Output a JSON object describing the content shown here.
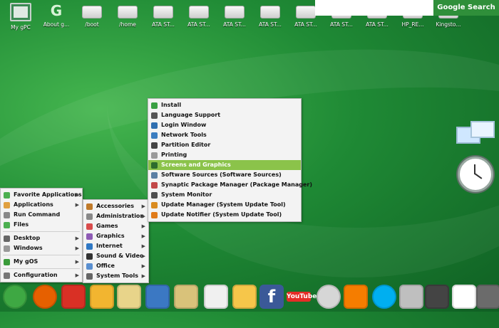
{
  "desktop_icons": [
    {
      "label": "My gPC",
      "icon": "monitor-icon"
    },
    {
      "label": "About g...",
      "icon": "about-icon"
    },
    {
      "label": "/boot",
      "icon": "drive-icon"
    },
    {
      "label": "/home",
      "icon": "drive-icon"
    },
    {
      "label": "ATA ST...",
      "icon": "drive-icon"
    },
    {
      "label": "ATA ST...",
      "icon": "drive-icon"
    },
    {
      "label": "ATA ST...",
      "icon": "drive-icon"
    },
    {
      "label": "ATA ST...",
      "icon": "drive-icon"
    },
    {
      "label": "ATA ST...",
      "icon": "drive-icon"
    },
    {
      "label": "ATA ST...",
      "icon": "drive-icon"
    },
    {
      "label": "ATA ST...",
      "icon": "drive-icon"
    },
    {
      "label": "HP_RE...",
      "icon": "drive-icon"
    },
    {
      "label": "Kingsto...",
      "icon": "drive-icon"
    }
  ],
  "search": {
    "value": "",
    "button_label": "Google Search"
  },
  "main_menu": [
    {
      "label": "Favorite Applications",
      "icon": "heart-icon",
      "color": "#4caf50",
      "submenu": true
    },
    {
      "label": "Applications",
      "icon": "apps-icon",
      "color": "#e0a040",
      "submenu": true
    },
    {
      "label": "Run Command",
      "icon": "gear-icon",
      "color": "#888888",
      "submenu": false
    },
    {
      "label": "Files",
      "icon": "files-icon",
      "color": "#4caf50",
      "submenu": false
    },
    {
      "label": "Desktop",
      "icon": "desktop-icon",
      "color": "#666666",
      "submenu": true
    },
    {
      "label": "Windows",
      "icon": "windows-icon",
      "color": "#999999",
      "submenu": true
    },
    {
      "label": "My gOS",
      "icon": "gos-icon",
      "color": "#3a9b3a",
      "submenu": true
    },
    {
      "label": "Configuration",
      "icon": "config-icon",
      "color": "#777777",
      "submenu": true
    }
  ],
  "apps_submenu": [
    {
      "label": "Accessories",
      "icon": "accessories-icon",
      "color": "#c07a2a"
    },
    {
      "label": "Administration",
      "icon": "admin-icon",
      "color": "#888888"
    },
    {
      "label": "Games",
      "icon": "games-icon",
      "color": "#d94c4c"
    },
    {
      "label": "Graphics",
      "icon": "graphics-icon",
      "color": "#8e5bb5"
    },
    {
      "label": "Internet",
      "icon": "internet-icon",
      "color": "#2f78c4"
    },
    {
      "label": "Sound & Video",
      "icon": "sound-video-icon",
      "color": "#333333"
    },
    {
      "label": "Office",
      "icon": "office-icon",
      "color": "#5a8fd0"
    },
    {
      "label": "System Tools",
      "icon": "system-tools-icon",
      "color": "#666666"
    }
  ],
  "system_menu": [
    {
      "label": "Install",
      "icon": "install-icon",
      "color": "#3aa043",
      "selected": false
    },
    {
      "label": "Language Support",
      "icon": "language-icon",
      "color": "#555555",
      "selected": false
    },
    {
      "label": "Login Window",
      "icon": "login-icon",
      "color": "#2f6fb0",
      "selected": false
    },
    {
      "label": "Network Tools",
      "icon": "network-icon",
      "color": "#3b7dc0",
      "selected": false
    },
    {
      "label": "Partition Editor",
      "icon": "partition-icon",
      "color": "#444444",
      "selected": false
    },
    {
      "label": "Printing",
      "icon": "printer-icon",
      "color": "#9a9a9a",
      "selected": false
    },
    {
      "label": "Screens and Graphics",
      "icon": "screens-icon",
      "color": "#2d6c2d",
      "selected": true
    },
    {
      "label": "Software Sources (Software Sources)",
      "icon": "software-sources-icon",
      "color": "#5b7fa3",
      "selected": false
    },
    {
      "label": "Synaptic Package Manager (Package Manager)",
      "icon": "synaptic-icon",
      "color": "#c24848",
      "selected": false
    },
    {
      "label": "System Monitor",
      "icon": "monitor-icon",
      "color": "#4f4f4f",
      "selected": false
    },
    {
      "label": "Update Manager (System Update Tool)",
      "icon": "update-icon",
      "color": "#d98b1f",
      "selected": false
    },
    {
      "label": "Update Notifier (System Update Tool)",
      "icon": "notifier-icon",
      "color": "#e07b1a",
      "selected": false
    }
  ],
  "dock_icons": [
    {
      "name": "gos-leaf-icon",
      "color": "#3ea843"
    },
    {
      "name": "firefox-icon",
      "color": "#e66000"
    },
    {
      "name": "gmail-icon",
      "color": "#d93025"
    },
    {
      "name": "pin-icon",
      "color": "#f2b530"
    },
    {
      "name": "notes-icon",
      "color": "#e8d48a"
    },
    {
      "name": "calendar-icon",
      "color": "#3b78c3"
    },
    {
      "name": "map-icon",
      "color": "#d9c27a"
    },
    {
      "name": "document-edit-icon",
      "color": "#f0f0f0"
    },
    {
      "name": "shopping-bag-icon",
      "color": "#f6c64a"
    },
    {
      "name": "facebook-icon",
      "color": "#3b5998",
      "text": "f"
    },
    {
      "name": "youtube-icon",
      "color": "#e52d27",
      "text": "YouTube"
    },
    {
      "name": "wikipedia-icon",
      "color": "#d6d6d6"
    },
    {
      "name": "blogger-icon",
      "color": "#f57d00"
    },
    {
      "name": "skype-icon",
      "color": "#00aff0"
    },
    {
      "name": "drive-icon",
      "color": "#bfbfbf"
    },
    {
      "name": "terminal-icon",
      "color": "#444444"
    },
    {
      "name": "home-icon",
      "color": "#ffffff"
    },
    {
      "name": "owl-icon",
      "color": "#6b6b6b"
    }
  ]
}
